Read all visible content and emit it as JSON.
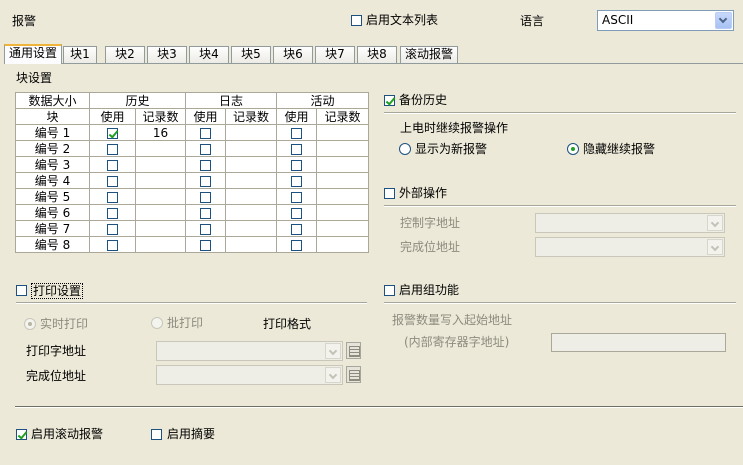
{
  "header": {
    "title": "报警",
    "text_list_label": "启用文本列表",
    "language_label": "语言",
    "language_value": "ASCII"
  },
  "tabs": [
    "通用设置",
    "块1",
    "块2",
    "块3",
    "块4",
    "块5",
    "块6",
    "块7",
    "块8",
    "滚动报警"
  ],
  "block_settings": {
    "title": "块设置",
    "headers": {
      "data_size": "数据大小",
      "history": "历史",
      "log": "日志",
      "active": "活动",
      "block": "块",
      "use": "使用",
      "count": "记录数"
    },
    "rows": [
      {
        "label": "编号 1",
        "history_use": true,
        "history_count": "16",
        "log_use": false,
        "log_count": "",
        "active_use": false,
        "active_count": ""
      },
      {
        "label": "编号 2",
        "history_use": false,
        "history_count": "",
        "log_use": false,
        "log_count": "",
        "active_use": false,
        "active_count": ""
      },
      {
        "label": "编号 3",
        "history_use": false,
        "history_count": "",
        "log_use": false,
        "log_count": "",
        "active_use": false,
        "active_count": ""
      },
      {
        "label": "编号 4",
        "history_use": false,
        "history_count": "",
        "log_use": false,
        "log_count": "",
        "active_use": false,
        "active_count": ""
      },
      {
        "label": "编号 5",
        "history_use": false,
        "history_count": "",
        "log_use": false,
        "log_count": "",
        "active_use": false,
        "active_count": ""
      },
      {
        "label": "编号 6",
        "history_use": false,
        "history_count": "",
        "log_use": false,
        "log_count": "",
        "active_use": false,
        "active_count": ""
      },
      {
        "label": "编号 7",
        "history_use": false,
        "history_count": "",
        "log_use": false,
        "log_count": "",
        "active_use": false,
        "active_count": ""
      },
      {
        "label": "编号 8",
        "history_use": false,
        "history_count": "",
        "log_use": false,
        "log_count": "",
        "active_use": false,
        "active_count": ""
      }
    ]
  },
  "backup_history": {
    "label": "备份历史",
    "checked": true,
    "power_on_title": "上电时继续报警操作",
    "option_new": "显示为新报警",
    "option_hide": "隐藏继续报警",
    "selected": "option_hide"
  },
  "external_op": {
    "label": "外部操作",
    "checked": false,
    "control_addr_label": "控制字地址",
    "complete_addr_label": "完成位地址"
  },
  "print_settings": {
    "label": "打印设置",
    "checked": false,
    "realtime_label": "实时打印",
    "batch_label": "批打印",
    "format_label": "打印格式",
    "print_addr_label": "打印字地址",
    "complete_addr_label": "完成位地址"
  },
  "group_function": {
    "label": "启用组功能",
    "checked": false,
    "count_addr_label": "报警数量写入起始地址",
    "internal_reg_label": "(内部寄存器字地址)"
  },
  "footer": {
    "scroll_alarm_label": "启用滚动报警",
    "scroll_alarm_checked": true,
    "summary_label": "启用摘要",
    "summary_checked": false
  }
}
